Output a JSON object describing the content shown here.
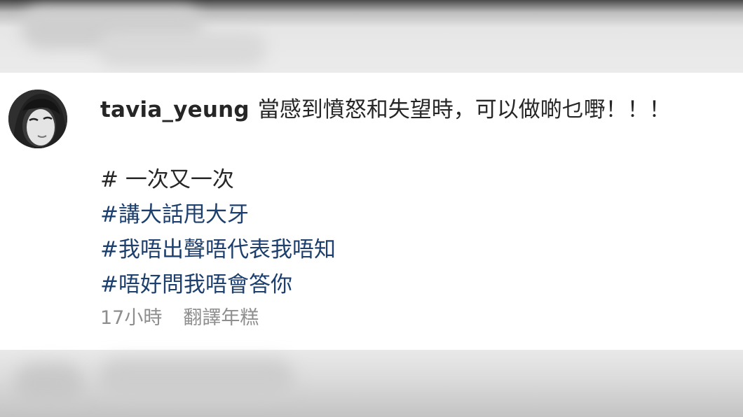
{
  "comment": {
    "username": "tavia_yeung",
    "text": "當感到憤怒和失望時，可以做啲乜嘢！！！",
    "hashtags": [
      {
        "text": "# 一次又一次",
        "linked": false
      },
      {
        "text": "#講大話甩大牙",
        "linked": true
      },
      {
        "text": "#我唔出聲唔代表我唔知",
        "linked": true
      },
      {
        "text": "#唔好問我唔會答你",
        "linked": true
      }
    ],
    "timestamp": "17小時",
    "translate_label": "翻譯年糕"
  },
  "colors": {
    "text": "#262626",
    "hashtag_link": "#1d3f6e",
    "meta": "#8e8e8e",
    "card_background": "#ffffff"
  }
}
